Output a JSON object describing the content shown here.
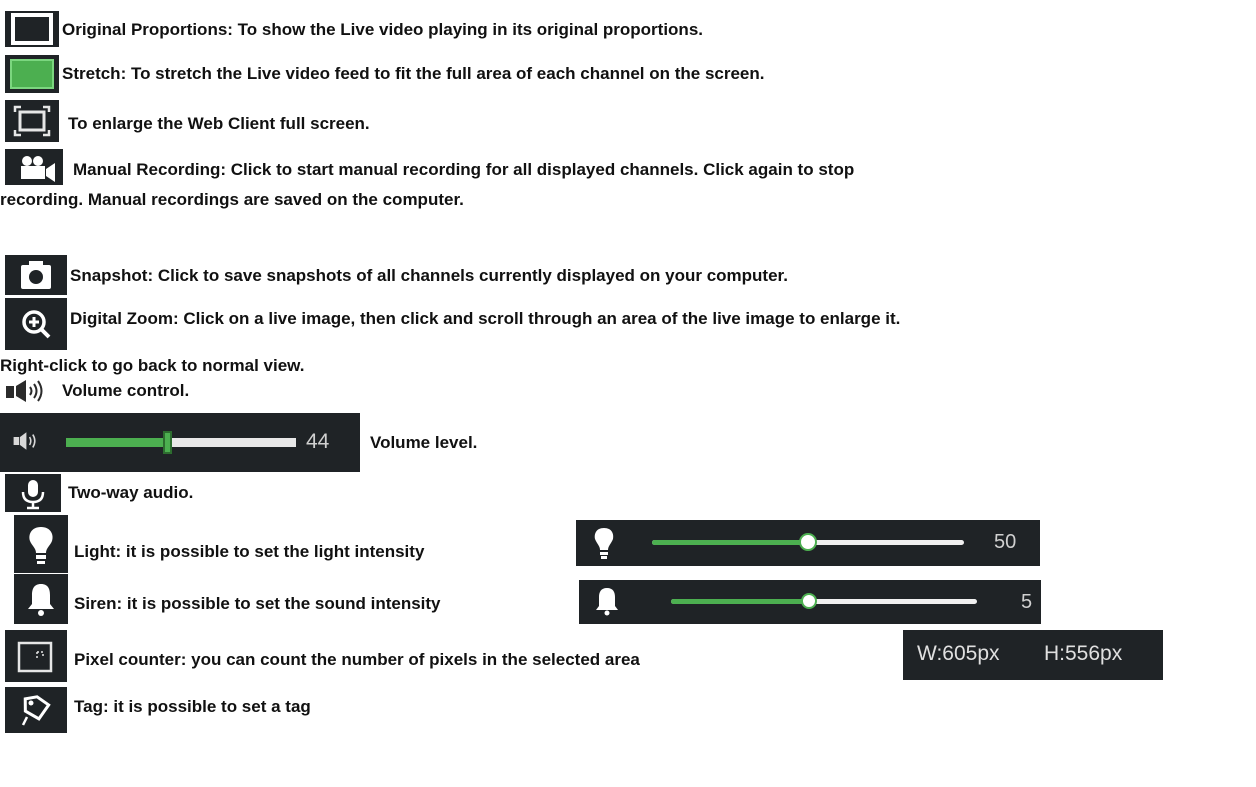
{
  "items": {
    "original_proportions": "Original Proportions: To show the Live video playing in its original proportions.",
    "stretch": "Stretch: To stretch the Live video feed to fit the full area of each channel on the screen.",
    "fullscreen": "To enlarge the Web Client full screen.",
    "manual_recording_line1": "Manual Recording: Click to start manual recording for all displayed channels. Click again to stop",
    "manual_recording_line2": "recording. Manual recordings are saved on the computer.",
    "snapshot": "Snapshot: Click to save snapshots of all channels currently displayed on your computer.",
    "digital_zoom_line1": "Digital Zoom: Click on a live image, then click and scroll through an area of the live image to enlarge it.",
    "digital_zoom_line2": "Right-click to go back to normal view.",
    "volume_control": "Volume control.",
    "volume_level": "Volume level.",
    "two_way_audio": "Two-way audio.",
    "light": "Light: it is possible to set the light intensity",
    "siren": "Siren: it is possible to set the sound intensity",
    "pixel_counter": "Pixel counter: you can count the number of pixels in the selected area",
    "tag": "Tag: it is possible to set a tag"
  },
  "controls": {
    "volume": {
      "value_label": "44",
      "level": 0.44
    },
    "light": {
      "value_label": "50",
      "level": 0.5
    },
    "siren": {
      "value_label": "5",
      "level": 0.5
    },
    "pixel_width": "W:605px",
    "pixel_height": "H:556px"
  },
  "icons": [
    "original-proportions-icon",
    "stretch-icon",
    "fullscreen-icon",
    "video-camera-icon",
    "camera-icon",
    "zoom-in-icon",
    "speaker-icon",
    "microphone-icon",
    "light-bulb-icon",
    "bell-icon",
    "pixel-counter-icon",
    "tag-icon"
  ],
  "colors": {
    "icon_bg": "#1f2326",
    "accent_green": "#4caf50",
    "slider_track": "#e8e8e8"
  }
}
